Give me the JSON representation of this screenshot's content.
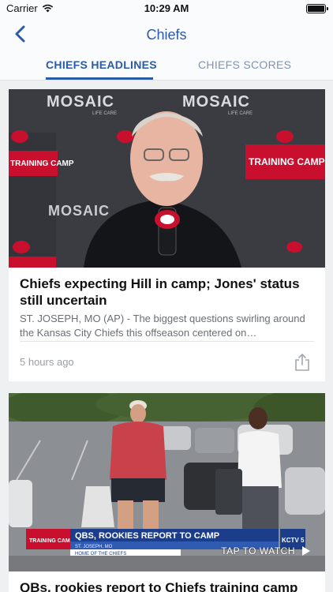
{
  "status": {
    "carrier": "Carrier",
    "time": "10:29 AM"
  },
  "nav": {
    "title": "Chiefs"
  },
  "tabs": [
    {
      "label": "CHIEFS HEADLINES",
      "active": true
    },
    {
      "label": "CHIEFS SCORES",
      "active": false
    }
  ],
  "articles": [
    {
      "title": "Chiefs expecting Hill in camp; Jones' status still uncertain",
      "summary": "ST. JOSEPH, MO (AP) - The biggest questions swirling around the Kansas City Chiefs this offseason centered on…",
      "time": "5 hours ago",
      "image": {
        "backdrop_text": "MOSAIC",
        "backdrop_sub": "LIFE CARE",
        "banner_text": "TRAINING CAMP"
      }
    },
    {
      "title": "QBs, rookies report to Chiefs training camp",
      "image": {
        "chyron_tag": "TRAINING CAMP",
        "chyron_headline": "QBS, ROOKIES REPORT TO CAMP",
        "chyron_location": "ST. JOSEPH, MO",
        "chyron_sub": "HOME OF THE CHIEFS",
        "station": "KCTV 5",
        "overlay": "TAP TO WATCH"
      }
    }
  ],
  "colors": {
    "accent": "#2a5aa8",
    "tab_inactive": "#8193b0",
    "chiefs_red": "#c8102e"
  }
}
